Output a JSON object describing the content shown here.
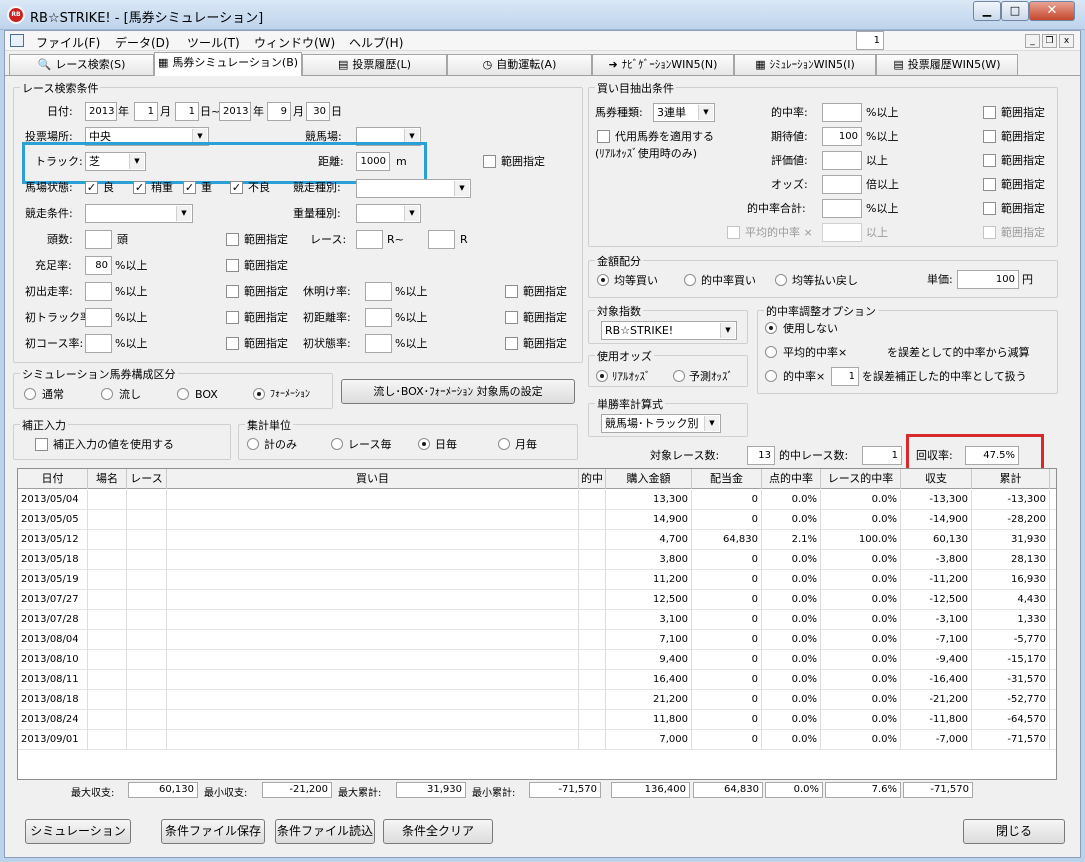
{
  "window": {
    "title": "RB☆STRIKE! - [馬券シミュレーション]",
    "app_icon_text": "RB"
  },
  "menu": [
    "ファイル(F)",
    "データ(D)",
    "ツール(T)",
    "ウィンドウ(W)",
    "ヘルプ(H)"
  ],
  "tabs": [
    "レース検索(S)",
    "馬券シミュレーション(B)",
    "投票履歴(L)",
    "自動運転(A)",
    "ﾅﾋﾞｹﾞｰｼｮﾝWIN5(N)",
    "ｼﾐｭﾚｰｼｮﾝWIN5(I)",
    "投票履歴WIN5(W)"
  ],
  "search": {
    "group_label": "レース検索条件",
    "date_label": "日付:",
    "from_year": "2013",
    "from_month": "1",
    "from_day": "1",
    "to_year": "2013",
    "to_month": "9",
    "to_day": "30",
    "year_unit": "年",
    "month_unit": "月",
    "day_range": "日~",
    "day_unit": "日",
    "venue_label": "投票場所:",
    "venue_value": "中央",
    "racecourse_label": "競馬場:",
    "racecourse_value": "",
    "track_label": "トラック:",
    "track_value": "芝",
    "distance_label": "距離:",
    "distance_value": "1000",
    "distance_unit": "m",
    "range_label": "範囲指定",
    "condition_label": "馬場状態:",
    "conditions": [
      "良",
      "稍重",
      "重",
      "不良"
    ],
    "race_type_label": "競走種別:",
    "race_cond_label": "競走条件:",
    "weight_type_label": "重量種別:",
    "heads_label": "頭数:",
    "heads_unit": "頭",
    "race_label": "レース:",
    "race_from_unit": "R~",
    "race_to_unit": "R",
    "fill_label": "充足率:",
    "fill_value": "80",
    "pct_over": "%以上",
    "first_run_label": "初出走率:",
    "rest_label": "休明け率:",
    "first_track_label": "初トラック率:",
    "first_dist_label": "初距離率:",
    "first_course_label": "初コース率:",
    "first_cond_label": "初状態率:"
  },
  "buy": {
    "group_label": "買い目抽出条件",
    "bet_type_label": "馬券種類:",
    "bet_type_value": "3連単",
    "substitute_label": "代用馬券を適用する",
    "substitute_note": "(ﾘｱﾙｵｯｽﾞ使用時のみ)",
    "hit_rate_label": "的中率:",
    "hit_rate_unit": "%以上",
    "expect_label": "期待値:",
    "expect_value": "100",
    "expect_unit": "%以上",
    "rating_label": "評価値:",
    "rating_unit": "以上",
    "odds_label": "オッズ:",
    "odds_unit": "倍以上",
    "hit_total_label": "的中率合計:",
    "hit_total_unit": "%以上",
    "avg_hit_label": "平均的中率 ×",
    "avg_hit_unit": "以上",
    "range_label": "範囲指定"
  },
  "alloc": {
    "group_label": "金額配分",
    "options": [
      "均等買い",
      "的中率買い",
      "均等払い戻し"
    ],
    "unit_label": "単価:",
    "unit_value": "100",
    "unit_suffix": "円"
  },
  "target": {
    "group_label": "対象指数",
    "value": "RB☆STRIKE!"
  },
  "odds_use": {
    "group_label": "使用オッズ",
    "options": [
      "ﾘｱﾙｵｯｽﾞ",
      "予測ｵｯｽﾞ"
    ]
  },
  "formula": {
    "group_label": "単勝率計算式",
    "value": "競馬場･トラック別"
  },
  "adjust": {
    "group_label": "的中率調整オプション",
    "none_label": "使用しない",
    "opt2_pre": "平均的中率×",
    "opt2_value": "1",
    "opt2_post": "を誤差として的中率から減算",
    "opt3_pre": "的中率×",
    "opt3_value": "1",
    "opt3_post": "を誤差補正した的中率として扱う"
  },
  "composition": {
    "group_label": "シミュレーション馬券構成区分",
    "options": [
      "通常",
      "流し",
      "BOX",
      "ﾌｫｰﾒｰｼｮﾝ"
    ],
    "setting_button": "流し･BOX･ﾌｫｰﾒｰｼｮﾝ 対象馬の設定"
  },
  "correction": {
    "group_label": "補正入力",
    "checkbox": "補正入力の値を使用する"
  },
  "aggregate": {
    "group_label": "集計単位",
    "options": [
      "計のみ",
      "レース毎",
      "日毎",
      "月毎"
    ]
  },
  "stats": {
    "target_races_label": "対象レース数:",
    "target_races": "13",
    "hit_races_label": "的中レース数:",
    "hit_races": "1",
    "recovery_label": "回収率:",
    "recovery": "47.5%"
  },
  "table": {
    "headers": [
      "日付",
      "場名",
      "レース",
      "買い目",
      "的中",
      "購入金額",
      "配当金",
      "点的中率",
      "レース的中率",
      "収支",
      "累計"
    ],
    "rows": [
      [
        "2013/05/04",
        "",
        "",
        "",
        "",
        "13,300",
        "0",
        "0.0%",
        "0.0%",
        "-13,300",
        "-13,300"
      ],
      [
        "2013/05/05",
        "",
        "",
        "",
        "",
        "14,900",
        "0",
        "0.0%",
        "0.0%",
        "-14,900",
        "-28,200"
      ],
      [
        "2013/05/12",
        "",
        "",
        "",
        "",
        "4,700",
        "64,830",
        "2.1%",
        "100.0%",
        "60,130",
        "31,930"
      ],
      [
        "2013/05/18",
        "",
        "",
        "",
        "",
        "3,800",
        "0",
        "0.0%",
        "0.0%",
        "-3,800",
        "28,130"
      ],
      [
        "2013/05/19",
        "",
        "",
        "",
        "",
        "11,200",
        "0",
        "0.0%",
        "0.0%",
        "-11,200",
        "16,930"
      ],
      [
        "2013/07/27",
        "",
        "",
        "",
        "",
        "12,500",
        "0",
        "0.0%",
        "0.0%",
        "-12,500",
        "4,430"
      ],
      [
        "2013/07/28",
        "",
        "",
        "",
        "",
        "3,100",
        "0",
        "0.0%",
        "0.0%",
        "-3,100",
        "1,330"
      ],
      [
        "2013/08/04",
        "",
        "",
        "",
        "",
        "7,100",
        "0",
        "0.0%",
        "0.0%",
        "-7,100",
        "-5,770"
      ],
      [
        "2013/08/10",
        "",
        "",
        "",
        "",
        "9,400",
        "0",
        "0.0%",
        "0.0%",
        "-9,400",
        "-15,170"
      ],
      [
        "2013/08/11",
        "",
        "",
        "",
        "",
        "16,400",
        "0",
        "0.0%",
        "0.0%",
        "-16,400",
        "-31,570"
      ],
      [
        "2013/08/18",
        "",
        "",
        "",
        "",
        "21,200",
        "0",
        "0.0%",
        "0.0%",
        "-21,200",
        "-52,770"
      ],
      [
        "2013/08/24",
        "",
        "",
        "",
        "",
        "11,800",
        "0",
        "0.0%",
        "0.0%",
        "-11,800",
        "-64,570"
      ],
      [
        "2013/09/01",
        "",
        "",
        "",
        "",
        "7,000",
        "0",
        "0.0%",
        "0.0%",
        "-7,000",
        "-71,570"
      ]
    ]
  },
  "summary": {
    "max_income_label": "最大収支:",
    "max_income": "60,130",
    "min_income_label": "最小収支:",
    "min_income": "-21,200",
    "max_cum_label": "最大累計:",
    "max_cum": "31,930",
    "min_cum_label": "最小累計:",
    "min_cum": "-71,570",
    "total_purchase": "136,400",
    "total_payout": "64,830",
    "total_point_rate": "0.0%",
    "total_race_rate": "7.6%",
    "total_income": "-71,570"
  },
  "footer": {
    "simulate": "シミュレーション",
    "save": "条件ファイル保存",
    "load": "条件ファイル読込",
    "clear": "条件全クリア",
    "close": "閉じる"
  },
  "colors": {
    "highlight_blue": "#2aa0d6",
    "highlight_red": "#d82a2a",
    "title_bar": "#c9dcf1"
  }
}
